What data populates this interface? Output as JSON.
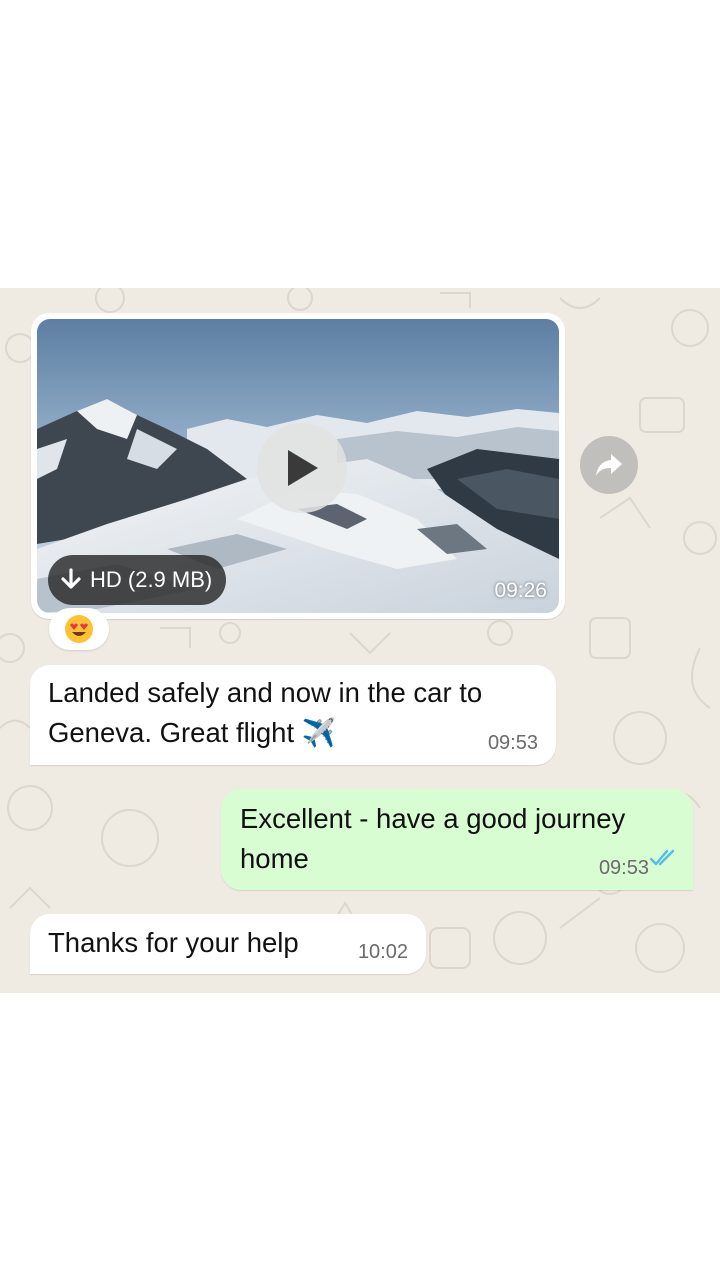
{
  "video_message": {
    "download_label": "HD (2.9 MB)",
    "duration": "09:26",
    "reaction_emoji": "😍",
    "play_icon": "play-icon",
    "download_icon": "download-arrow-icon",
    "forward_icon": "forward-share-icon"
  },
  "messages": [
    {
      "direction": "incoming",
      "text_line1": "Landed safely and now in the car to",
      "text_line2": "Geneva. Great flight ✈️",
      "time": "09:53"
    },
    {
      "direction": "outgoing",
      "text_line1": "Excellent - have a good journey",
      "text_line2": "home",
      "time": "09:53",
      "status_icon": "double-check-read-icon"
    },
    {
      "direction": "incoming",
      "text": "Thanks for your help",
      "time": "10:02"
    }
  ],
  "colors": {
    "chat_background": "#efeae2",
    "incoming_bubble": "#ffffff",
    "outgoing_bubble": "#d9fdd3",
    "read_ticks": "#53bdeb",
    "timestamp": "#6b6b6b"
  }
}
